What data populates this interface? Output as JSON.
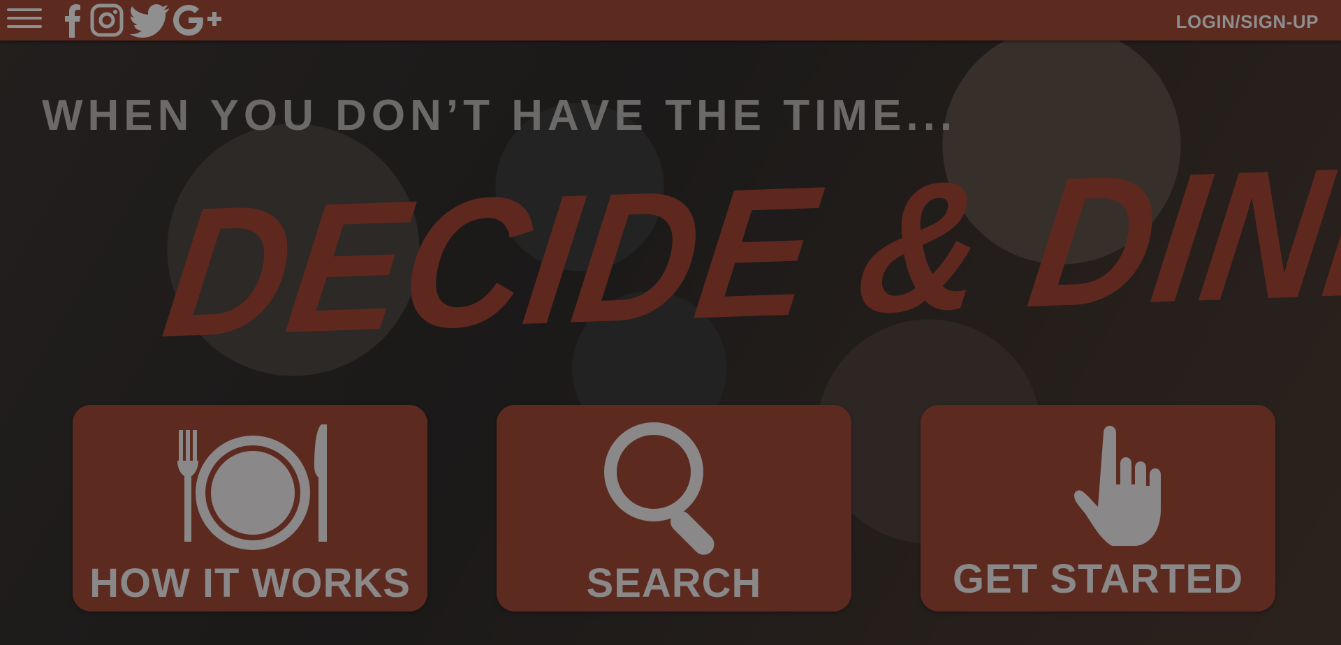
{
  "header": {
    "social_icons": [
      "facebook-icon",
      "instagram-icon",
      "twitter-icon",
      "google-plus-icon"
    ],
    "login_label": "LOGIN/SIGN-UP"
  },
  "hero": {
    "tagline": "WHEN YOU DON’T HAVE THE TIME...",
    "brand": "DECIDE & DINE"
  },
  "cards": [
    {
      "label": "HOW IT WORKS",
      "icon": "plate-fork-knife-icon"
    },
    {
      "label": "SEARCH",
      "icon": "magnifier-icon"
    },
    {
      "label": "GET STARTED",
      "icon": "pointing-hand-icon"
    }
  ],
  "colors": {
    "accent": "#5d2a20",
    "text_muted": "#8e8e8e"
  }
}
